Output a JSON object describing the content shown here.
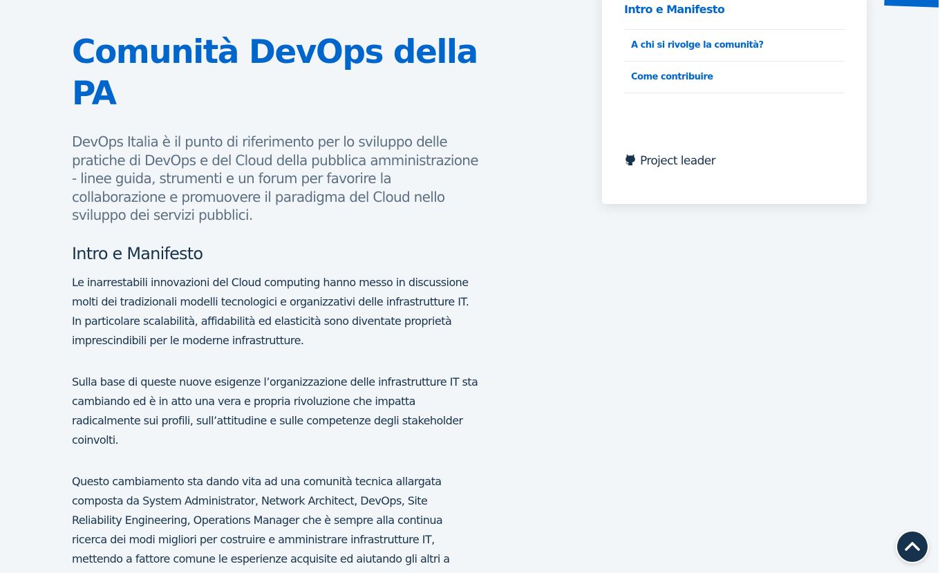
{
  "main": {
    "title": "Comunità DevOps della PA",
    "lead": "DevOps Italia è il punto di riferimento per lo sviluppo delle pratiche di DevOps e del Cloud della pubblica amministrazione - linee guida, strumenti e un forum per favorire la collaborazione e promuovere il paradigma del Cloud nello sviluppo dei servizi pubblici.",
    "section_title": "Intro e Manifesto",
    "paragraphs": [
      "Le inarrestabili innovazioni del Cloud computing hanno messo in discussione molti dei tradizionali modelli tecnologici e organizzativi delle infrastrutture IT. In particolare scalabilità, affidabilità ed elasticità sono diventate proprietà imprescindibili per le moderne infrastrutture.",
      "Sulla base di queste nuove esigenze l’organizzazione delle infrastrutture IT sta cambiando ed è in atto una vera e propria rivoluzione che impatta radicalmente sui profili, sull’attitudine e sulle competenze degli stakeholder coinvolti.",
      "Questo cambiamento sta dando vita ad una comunità tecnica allargata composta da System Administrator, Network Architect, DevOps, Site Reliability Engineering, Operations Manager che è sempre alla continua ricerca dei modi migliori per costruire e amministrare infrastrutture IT, mettendo a fattore comune le esperienze acquisite ed aiutando gli altri a"
    ]
  },
  "sidebar": {
    "toc_header": "Intro e Manifesto",
    "toc_items": [
      {
        "label": "A chi si rivolge la comunità?"
      },
      {
        "label": "Come contribuire"
      }
    ],
    "project_leader_label": "Project leader",
    "project_leader_icon": "github-icon"
  },
  "back_to_top": {
    "icon": "chevron-up-icon"
  },
  "colors": {
    "accent": "#0066cc",
    "text_dark": "#17324d",
    "text_muted": "#5c6f82",
    "page_bg": "#f3f6f9",
    "card_bg": "#ffffff"
  }
}
